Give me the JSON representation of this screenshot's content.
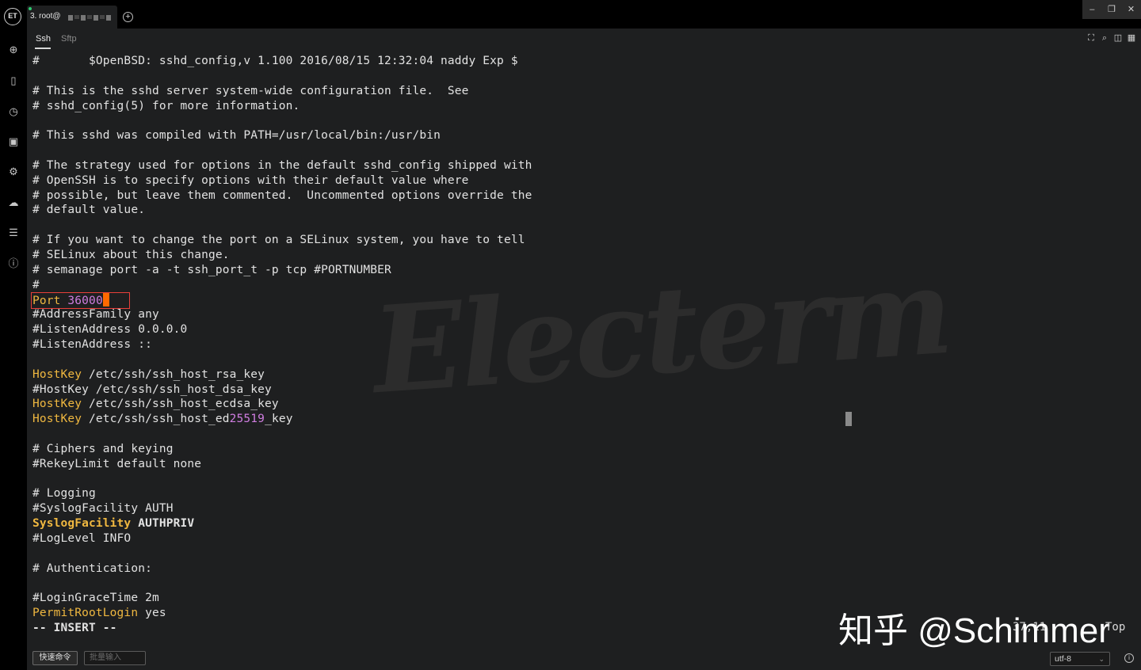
{
  "app": {
    "logo_text": "ET"
  },
  "tab": {
    "label": "3. root@",
    "add_icon": "plus-circle-icon"
  },
  "window_controls": {
    "minimize": "–",
    "restore": "❐",
    "close": "✕"
  },
  "sidebar": {
    "icons": [
      "add-circle-icon",
      "bookmark-icon",
      "history-icon",
      "image-icon",
      "gear-icon",
      "cloud-sync-icon",
      "list-icon",
      "info-icon"
    ]
  },
  "subtabs": {
    "ssh": "Ssh",
    "sftp": "Sftp"
  },
  "terminal": {
    "lines": [
      "#       $OpenBSD: sshd_config,v 1.100 2016/08/15 12:32:04 naddy Exp $",
      "",
      "# This is the sshd server system-wide configuration file.  See",
      "# sshd_config(5) for more information.",
      "",
      "# This sshd was compiled with PATH=/usr/local/bin:/usr/bin",
      "",
      "# The strategy used for options in the default sshd_config shipped with",
      "# OpenSSH is to specify options with their default value where",
      "# possible, but leave them commented.  Uncommented options override the",
      "# default value.",
      "",
      "# If you want to change the port on a SELinux system, you have to tell",
      "# SELinux about this change.",
      "# semanage port -a -t ssh_port_t -p tcp #PORTNUMBER",
      "#"
    ],
    "port_keyword": "Port",
    "port_value": "36000",
    "lines2": [
      "#AddressFamily any",
      "#ListenAddress 0.0.0.0",
      "#ListenAddress ::",
      ""
    ],
    "hostkey_kw": "HostKey",
    "hostkey_rsa": " /etc/ssh/ssh_host_rsa_key",
    "hostkey_dsa": "#HostKey /etc/ssh/ssh_host_dsa_key",
    "hostkey_ecdsa": " /etc/ssh/ssh_host_ecdsa_key",
    "hostkey_ed_a": " /etc/ssh/ssh_host_ed",
    "hostkey_ed_num": "25519",
    "hostkey_ed_b": "_key",
    "lines3": [
      "",
      "# Ciphers and keying",
      "#RekeyLimit default none",
      "",
      "# Logging",
      "#SyslogFacility AUTH"
    ],
    "syslog_kw": "SyslogFacility",
    "syslog_val": " AUTHPRIV",
    "lines4": [
      "#LogLevel INFO",
      "",
      "# Authentication:",
      "",
      "#LoginGraceTime 2m"
    ],
    "permit_kw": "PermitRootLogin",
    "permit_val": " yes",
    "mode": "-- INSERT --"
  },
  "watermark": "Electerm",
  "status": {
    "position": "37,11",
    "scroll": "Top"
  },
  "zhihu_watermark": "知乎 @Schimmer",
  "bottom": {
    "quick_cmd": "快速命令",
    "batch_input_placeholder": "批量输入",
    "encoding": "utf-8"
  },
  "colors": {
    "keyword": "#f0b840",
    "number": "#cf7de0",
    "cursor": "#ff6a00",
    "highlight_box": "#e8403a"
  }
}
